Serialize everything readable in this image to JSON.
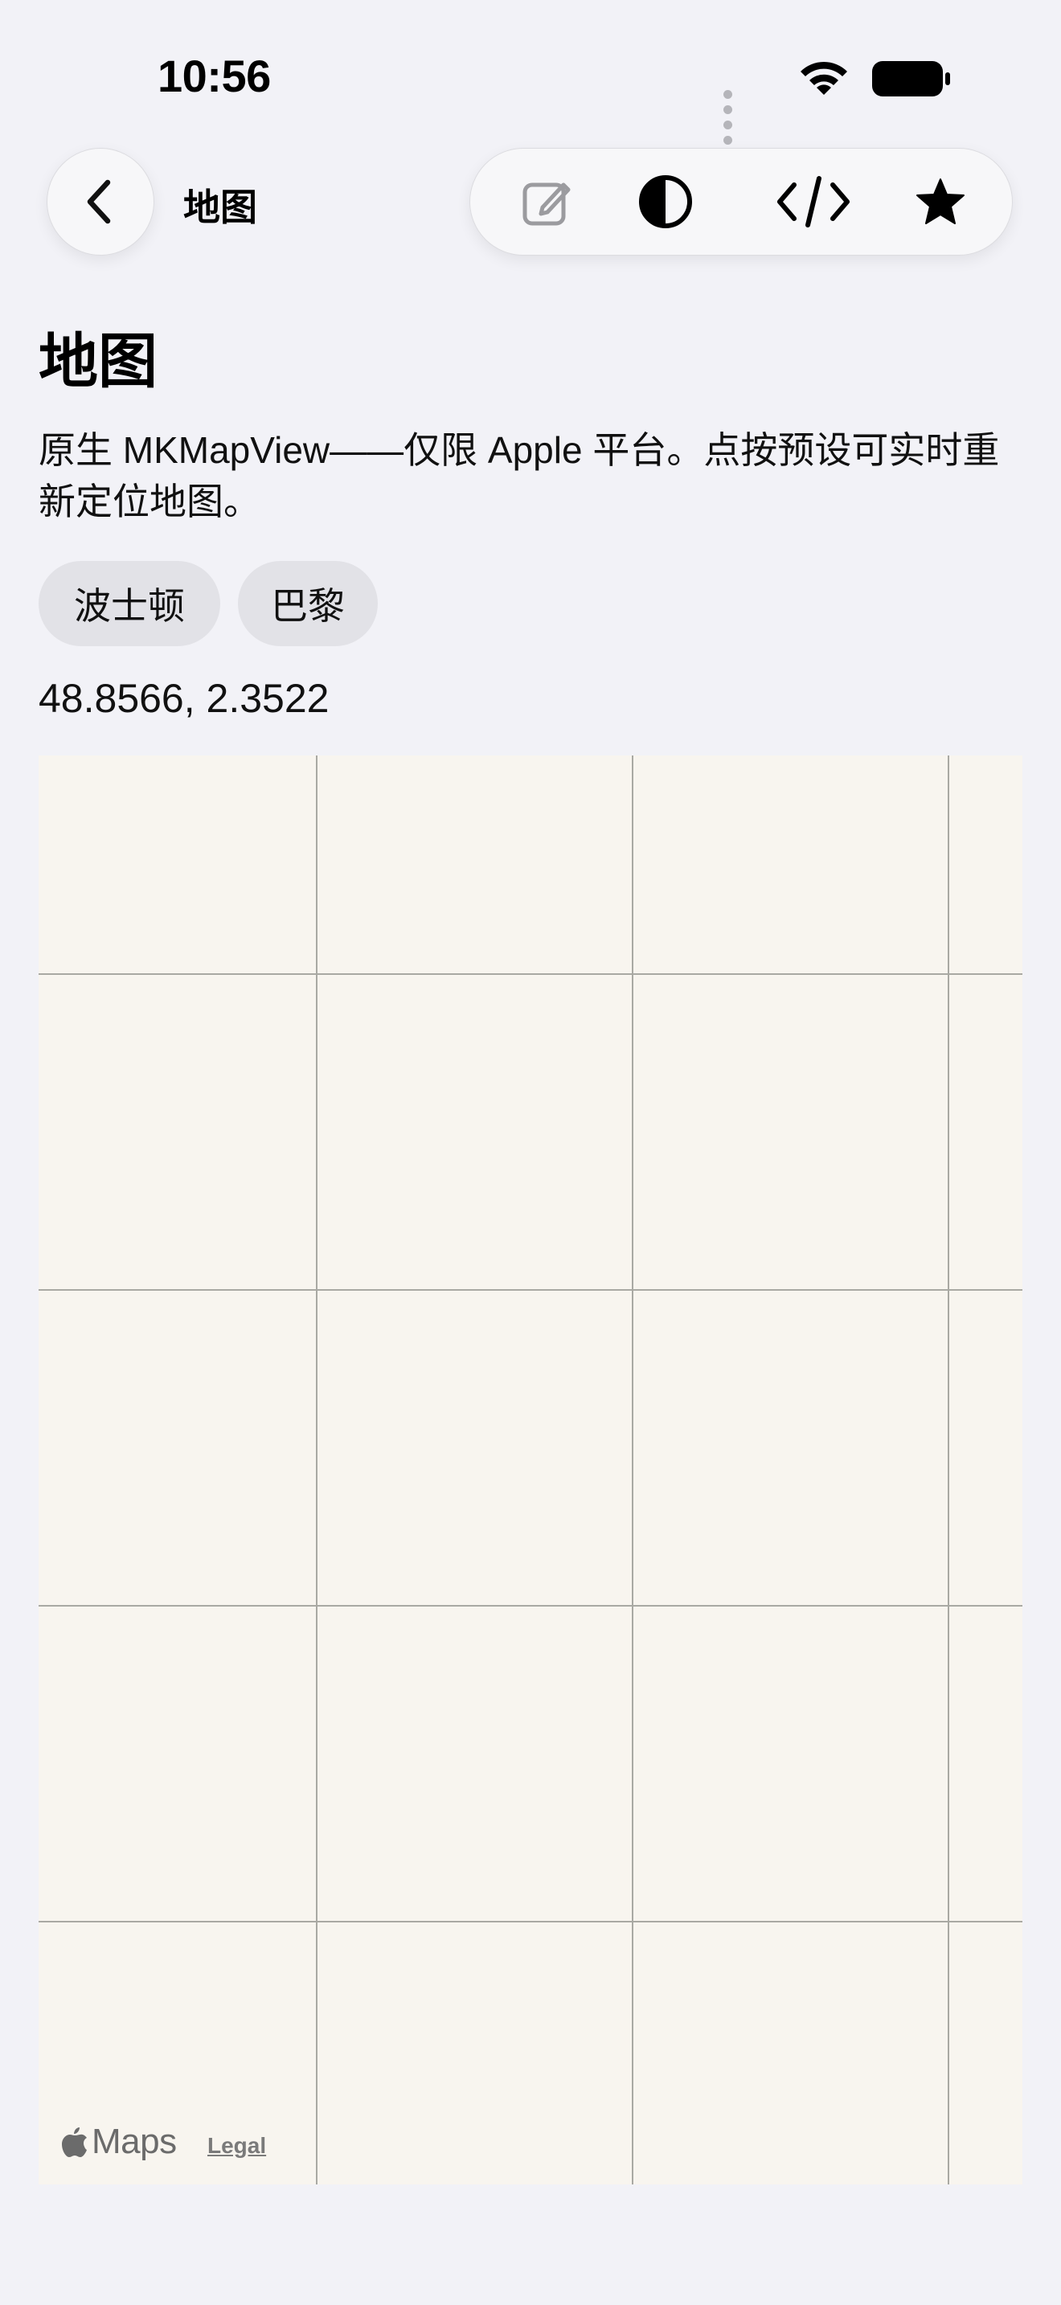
{
  "status_bar": {
    "time": "10:56"
  },
  "nav": {
    "title": "地图"
  },
  "page": {
    "title": "地图",
    "description": "原生 MKMapView——仅限 Apple 平台。点按预设可实时重新定位地图。",
    "presets": [
      {
        "label": "波士顿"
      },
      {
        "label": "巴黎"
      }
    ],
    "coordinates": "48.8566, 2.3522"
  },
  "map": {
    "brand": "Maps",
    "legal": "Legal",
    "background_color": "#f8f5ef",
    "grid_color": "#a9a9a3"
  },
  "icons": {
    "back": "chevron-left-icon",
    "edit": "pencil-square-icon",
    "contrast": "half-circle-icon",
    "code": "code-brackets-icon",
    "favorite": "star-icon",
    "logo": "apple-icon"
  }
}
